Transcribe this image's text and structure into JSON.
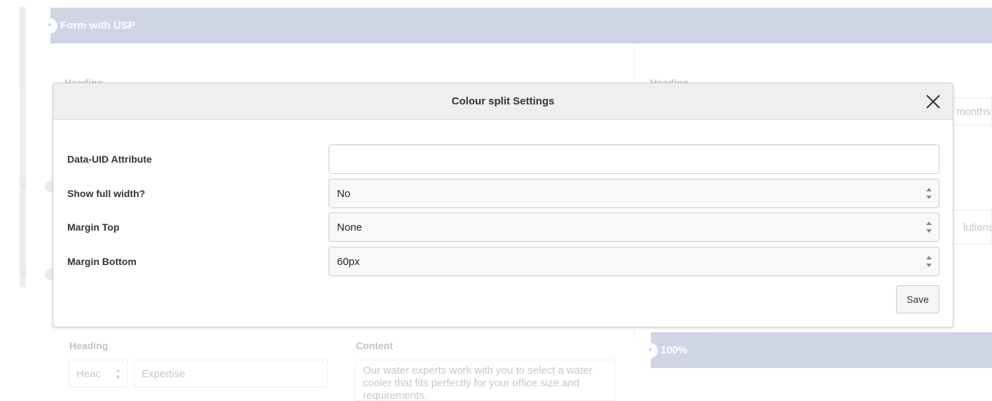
{
  "background": {
    "band_top_title": "Form with USP",
    "band_right_title": "100%",
    "heading_label_left": "Heading",
    "heading_label_right": "Heading",
    "right_text_1": "months",
    "right_text_2": "lutions.",
    "lower_heading_label": "Heading",
    "lower_content_label": "Content",
    "lower_select_value": "Heac",
    "lower_input_value": "Expertise",
    "lower_textarea_value": "Our water experts work with you to select a water cooler that fits perfectly for your office size and requirements."
  },
  "modal": {
    "title": "Colour split Settings",
    "fields": [
      {
        "label": "Data-UID Attribute",
        "type": "text",
        "value": ""
      },
      {
        "label": "Show full width?",
        "type": "select",
        "value": "No"
      },
      {
        "label": "Margin Top",
        "type": "select",
        "value": "None"
      },
      {
        "label": "Margin Bottom",
        "type": "select",
        "value": "60px"
      }
    ],
    "save_label": "Save"
  },
  "colors": {
    "band": "#6e7fb0",
    "modal_header": "#efefef",
    "field_border": "#cccccc"
  },
  "icons": {
    "close": "close-icon",
    "select": "select-arrows-icon",
    "collapse": "collapse-toggle-icon"
  }
}
